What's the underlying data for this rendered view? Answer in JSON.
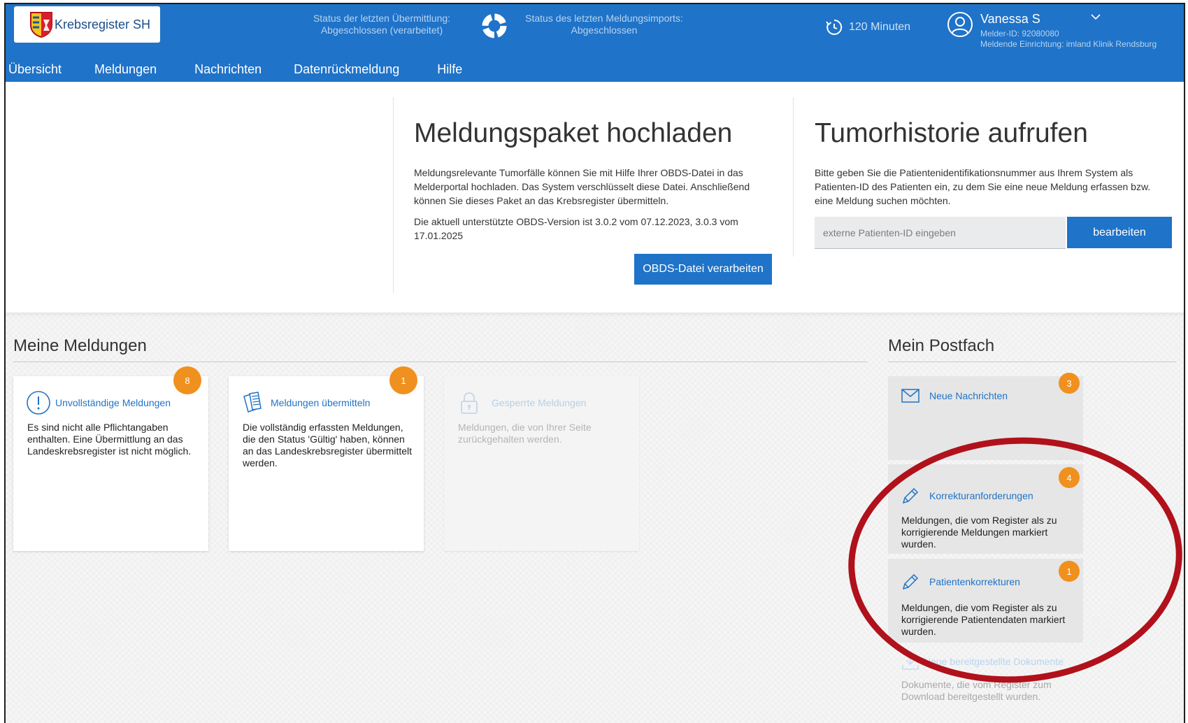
{
  "header": {
    "logo_text": "Krebsregister SH",
    "status_transfer": {
      "label": "Status der letzten Übermittlung:",
      "value": "Abgeschlossen (verarbeitet)"
    },
    "status_import": {
      "label": "Status des letzten Meldungsimports:",
      "value": "Abgeschlossen"
    },
    "session_timer": "120 Minuten",
    "user": {
      "name": "Vanessa S",
      "melder_id": "Melder-ID: 92080080",
      "facility": "Meldende Einrichtung: imland Klinik Rendsburg"
    },
    "colors": {
      "primary": "#1f73c8",
      "badge": "#f0901e",
      "highlight": "#b0111a"
    }
  },
  "nav": {
    "items": [
      {
        "label": "Übersicht"
      },
      {
        "label": "Meldungen"
      },
      {
        "label": "Nachrichten"
      },
      {
        "label": "Datenrückmeldung"
      },
      {
        "label": "Hilfe"
      }
    ]
  },
  "upload": {
    "title": "Meldungspaket hochladen",
    "text": "Meldungsrelevante Tumorfälle können Sie mit Hilfe Ihrer OBDS-Datei in das Melderportal hochladen. Das System verschlüsselt diese Datei. Anschließend können Sie dieses Paket an das Krebsregister übermitteln.",
    "version_text": "Die aktuell unterstützte OBDS-Version ist 3.0.2 vom 07.12.2023, 3.0.3 vom 17.01.2025",
    "button": "OBDS-Datei verarbeiten"
  },
  "tumor_history": {
    "title": "Tumorhistorie aufrufen",
    "text": "Bitte geben Sie die Patientenidentifikationsnummer aus Ihrem System als Patienten-ID des Patienten ein, zu dem Sie eine neue Meldung erfassen bzw. eine Meldung suchen möchten.",
    "input_placeholder": "externe Patienten-ID eingeben",
    "input_value": "",
    "button": "bearbeiten"
  },
  "my_reports": {
    "title": "Meine Meldungen",
    "cards": [
      {
        "title": "Unvollständige Meldungen",
        "text": "Es sind nicht alle Pflichtangaben enthalten. Eine Übermittlung an das Landeskrebsregister ist nicht möglich.",
        "badge": "8",
        "icon": "exclamation-icon"
      },
      {
        "title": "Meldungen übermitteln",
        "text": "Die vollständig erfassten Meldungen, die den Status 'Gültig' haben, können an das Landeskrebsregister übermittelt werden.",
        "badge": "1",
        "icon": "documents-icon"
      },
      {
        "title": "Gesperrte Meldungen",
        "text": "Meldungen, die von Ihrer Seite zurückgehalten werden.",
        "badge": "",
        "icon": "lock-icon"
      }
    ]
  },
  "mailbox": {
    "title": "Mein Postfach",
    "cards": [
      {
        "title": "Neue Nachrichten",
        "text": "",
        "badge": "3",
        "icon": "envelope-icon"
      },
      {
        "title": "Korrekturanforderungen",
        "text": "Meldungen, die vom Register als zu korrigierende Meldungen markiert wurden.",
        "badge": "4",
        "icon": "pencil-icon"
      },
      {
        "title": "Patientenkorrekturen",
        "text": "Meldungen, die vom Register als zu korrigierende Patientendaten markiert wurden.",
        "badge": "1",
        "icon": "pencil-icon"
      },
      {
        "title": "Neue bereitgestellte Dokumente",
        "text": "Dokumente, die vom Register zum Download bereitgestellt wurden.",
        "badge": "",
        "icon": "download-icon"
      }
    ]
  }
}
